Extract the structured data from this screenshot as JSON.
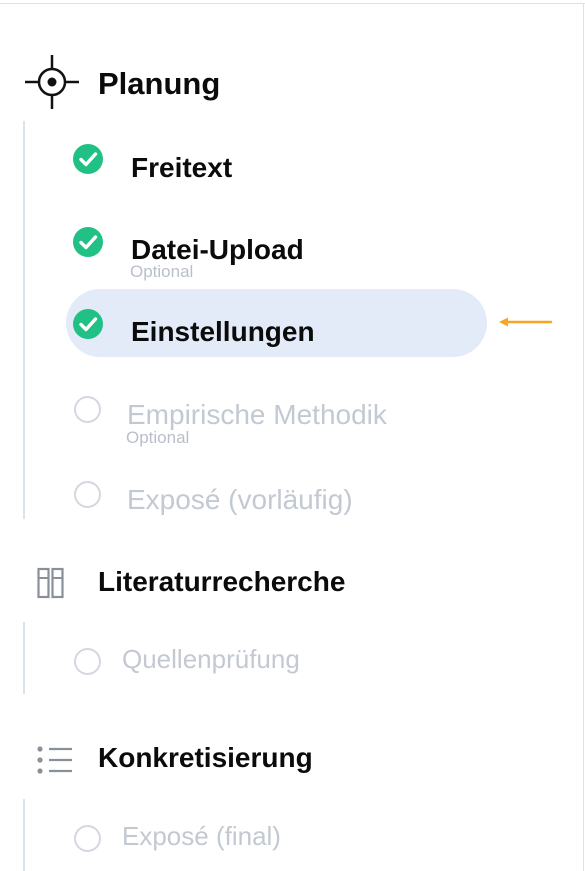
{
  "colors": {
    "done": "#21c085",
    "active_bg": "#e3ebf8",
    "indicator_arrow": "#f5a623",
    "pending_text": "#c3c9d2",
    "rail": "#dbe3ea"
  },
  "sections": [
    {
      "title": "Planung",
      "icon": "crosshair-icon",
      "steps": [
        {
          "label": "Freitext",
          "status": "done"
        },
        {
          "label": "Datei-Upload",
          "sublabel": "Optional",
          "status": "done"
        },
        {
          "label": "Einstellungen",
          "status": "done",
          "active": true
        },
        {
          "label": "Empirische Methodik",
          "sublabel": "Optional",
          "status": "pending"
        },
        {
          "label": "Exposé (vorläufig)",
          "status": "pending"
        }
      ]
    },
    {
      "title": "Literaturrecherche",
      "icon": "books-icon",
      "steps": [
        {
          "label": "Quellenprüfung",
          "status": "pending"
        }
      ]
    },
    {
      "title": "Konkretisierung",
      "icon": "list-icon",
      "steps": [
        {
          "label": "Exposé (final)",
          "status": "pending"
        }
      ]
    }
  ]
}
